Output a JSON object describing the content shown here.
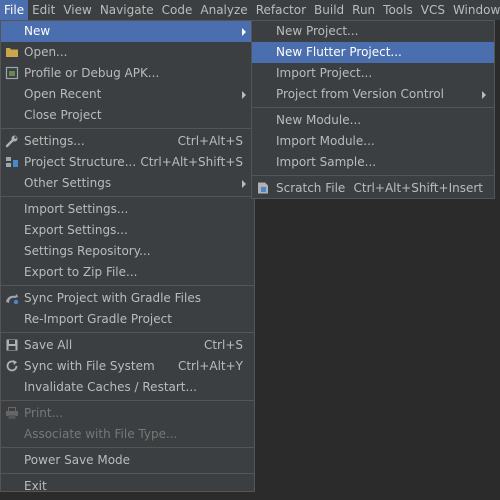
{
  "menubar": {
    "items": [
      "File",
      "Edit",
      "View",
      "Navigate",
      "Code",
      "Analyze",
      "Refactor",
      "Build",
      "Run",
      "Tools",
      "VCS",
      "Window"
    ]
  },
  "file_menu": {
    "new": "New",
    "open": "Open...",
    "profile_debug": "Profile or Debug APK...",
    "open_recent": "Open Recent",
    "close_project": "Close Project",
    "settings": "Settings...",
    "settings_shortcut": "Ctrl+Alt+S",
    "project_structure": "Project Structure...",
    "project_structure_shortcut": "Ctrl+Alt+Shift+S",
    "other_settings": "Other Settings",
    "import_settings": "Import Settings...",
    "export_settings": "Export Settings...",
    "settings_repository": "Settings Repository...",
    "export_zip": "Export to Zip File...",
    "sync_gradle": "Sync Project with Gradle Files",
    "reimport_gradle": "Re-Import Gradle Project",
    "save_all": "Save All",
    "save_all_shortcut": "Ctrl+S",
    "sync_fs": "Sync with File System",
    "sync_fs_shortcut": "Ctrl+Alt+Y",
    "invalidate_caches": "Invalidate Caches / Restart...",
    "print": "Print...",
    "associate_file_type": "Associate with File Type...",
    "power_save": "Power Save Mode",
    "exit": "Exit"
  },
  "new_menu": {
    "new_project": "New Project...",
    "new_flutter_project": "New Flutter Project...",
    "import_project": "Import Project...",
    "project_from_vcs": "Project from Version Control",
    "new_module": "New Module...",
    "import_module": "Import Module...",
    "import_sample": "Import Sample...",
    "scratch_file": "Scratch File",
    "scratch_file_shortcut": "Ctrl+Alt+Shift+Insert"
  },
  "colors": {
    "menu_bg": "#3c3f41",
    "selection": "#4b6eaf",
    "text": "#bbbbbb",
    "disabled_text": "#777777",
    "editor_bg": "#2b2b2b"
  }
}
